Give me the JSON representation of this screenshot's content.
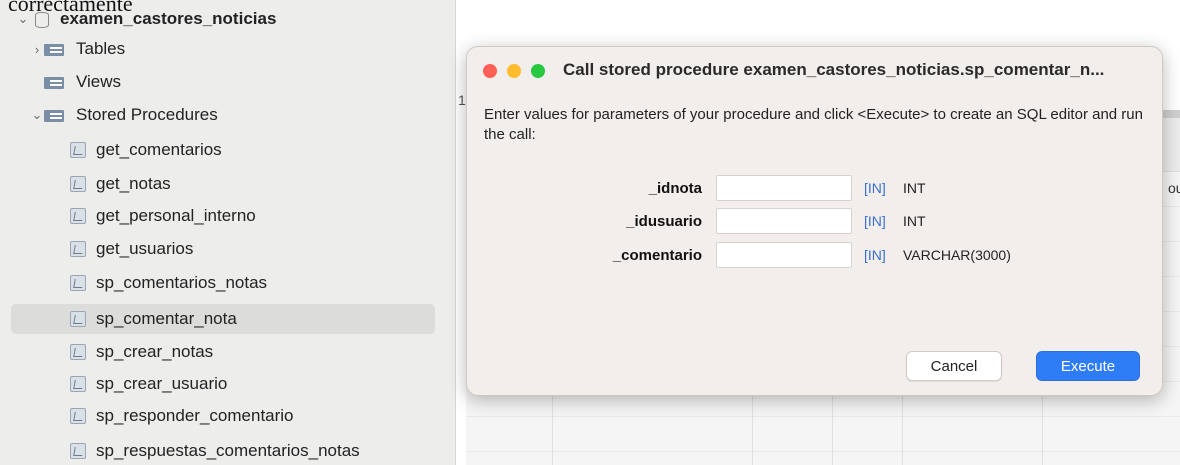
{
  "page": {
    "clipped_top_text": "correctamente"
  },
  "sidebar": {
    "schema": "examen_castores_noticias",
    "sections": [
      {
        "label": "Tables",
        "expanded": false
      },
      {
        "label": "Views",
        "expanded": null
      },
      {
        "label": "Stored Procedures",
        "expanded": true
      }
    ],
    "procedures": [
      "get_comentarios",
      "get_notas",
      "get_personal_interno",
      "get_usuarios",
      "sp_comentarios_notas",
      "sp_comentar_nota",
      "sp_crear_notas",
      "sp_crear_usuario",
      "sp_responder_comentario",
      "sp_respuestas_comentarios_notas"
    ],
    "selected_procedure": "sp_comentar_nota"
  },
  "background": {
    "row_number": "1",
    "edge_char": "ou"
  },
  "dialog": {
    "title": "Call stored procedure examen_castores_noticias.sp_comentar_n...",
    "description": "Enter values for parameters of your procedure and click <Execute> to create an SQL editor and run the call:",
    "params": [
      {
        "name": "_idnota",
        "direction": "[IN]",
        "type": "INT",
        "value": ""
      },
      {
        "name": "_idusuario",
        "direction": "[IN]",
        "type": "INT",
        "value": ""
      },
      {
        "name": "_comentario",
        "direction": "[IN]",
        "type": "VARCHAR(3000)",
        "value": ""
      }
    ],
    "cancel_label": "Cancel",
    "execute_label": "Execute"
  },
  "colors": {
    "accent": "#2f7df6",
    "direction_text": "#3a6fd0",
    "dialog_bg": "#f2eeeb",
    "sidebar_bg": "#ededec"
  }
}
